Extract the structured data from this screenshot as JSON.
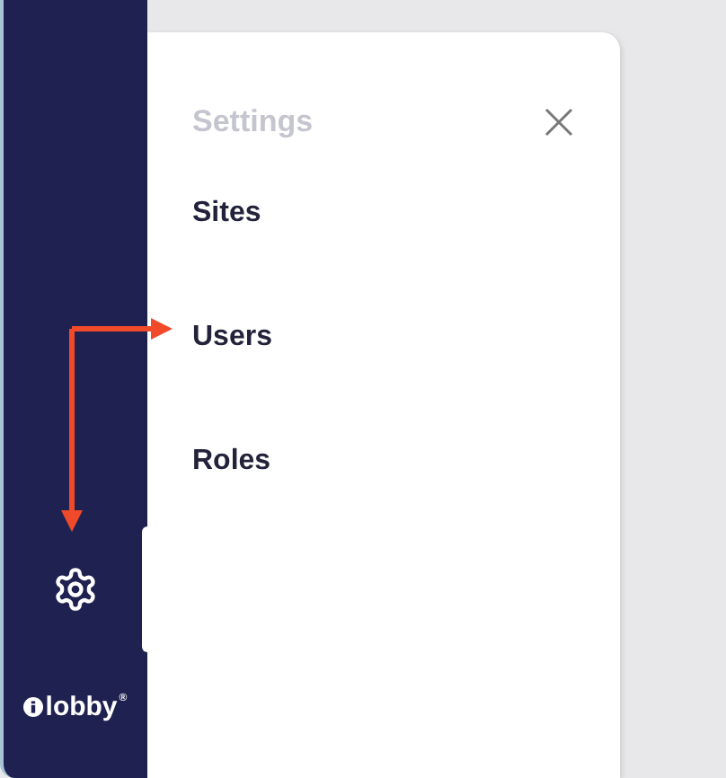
{
  "sidebar": {
    "logo": {
      "text": "lobby",
      "mark": "®"
    }
  },
  "settings_panel": {
    "title": "Settings",
    "items": [
      {
        "label": "Sites"
      },
      {
        "label": "Users"
      },
      {
        "label": "Roles"
      }
    ]
  }
}
